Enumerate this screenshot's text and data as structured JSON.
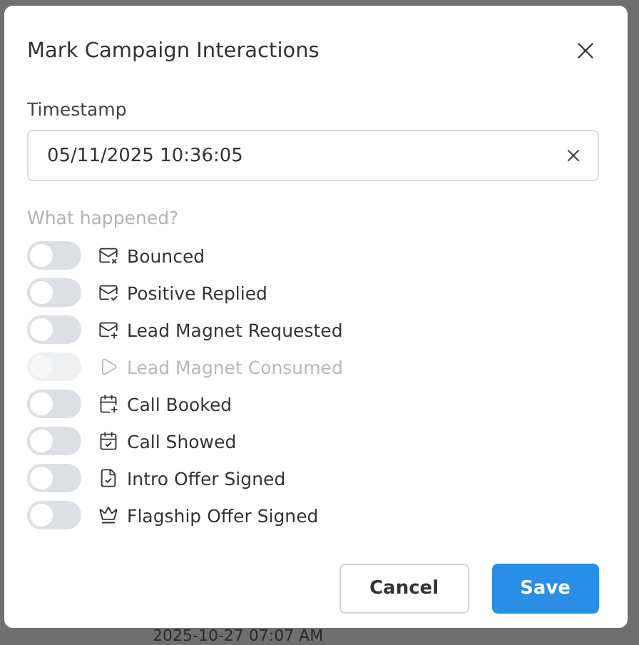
{
  "dialog": {
    "title": "Mark Campaign Interactions"
  },
  "timestamp": {
    "label": "Timestamp",
    "value": "05/11/2025 10:36:05"
  },
  "section_label": "What happened?",
  "interactions": [
    {
      "label": "Bounced",
      "on": false,
      "disabled": false
    },
    {
      "label": "Positive Replied",
      "on": false,
      "disabled": false
    },
    {
      "label": "Lead Magnet Requested",
      "on": false,
      "disabled": false
    },
    {
      "label": "Lead Magnet Consumed",
      "on": false,
      "disabled": true
    },
    {
      "label": "Call Booked",
      "on": false,
      "disabled": false
    },
    {
      "label": "Call Showed",
      "on": false,
      "disabled": false
    },
    {
      "label": "Intro Offer Signed",
      "on": false,
      "disabled": false
    },
    {
      "label": "Flagship Offer Signed",
      "on": false,
      "disabled": false
    }
  ],
  "buttons": [
    {
      "label": "Cancel",
      "kind": "secondary"
    },
    {
      "label": "Save",
      "kind": "primary"
    }
  ],
  "background_text": "2025-10-27 07:07 AM"
}
